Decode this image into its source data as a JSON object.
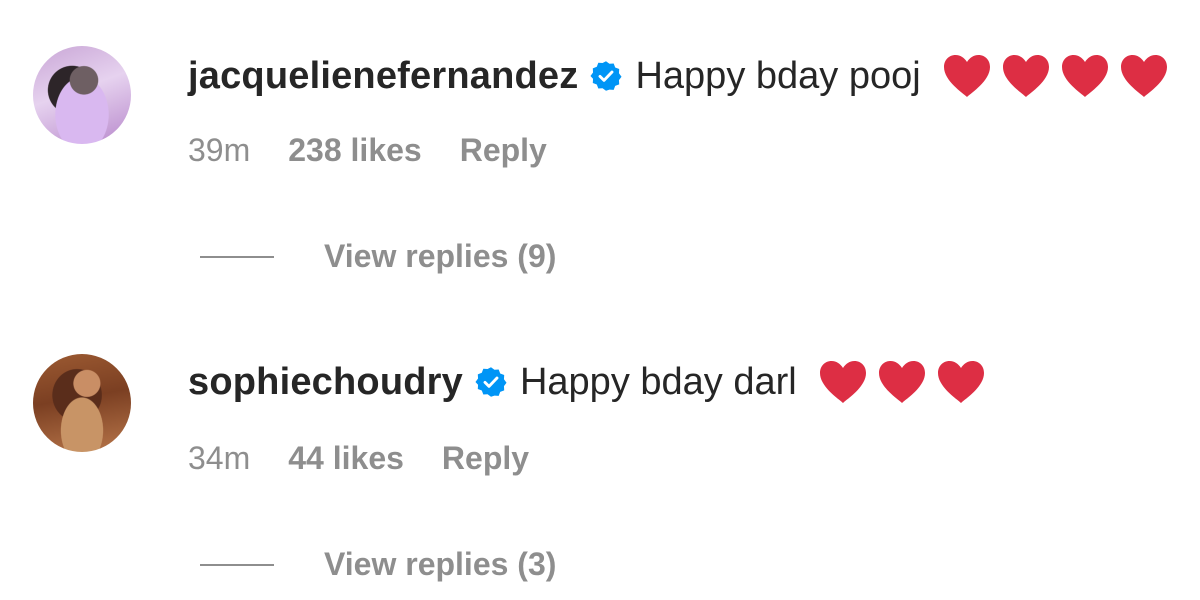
{
  "comments": [
    {
      "username": "jacquelienefernandez",
      "verified": true,
      "text": "Happy bday pooj",
      "hearts": 4,
      "time": "39m",
      "likes": "238 likes",
      "reply_label": "Reply",
      "view_replies": "View replies (9)"
    },
    {
      "username": "sophiechoudry",
      "verified": true,
      "text": "Happy bday darl",
      "hearts": 3,
      "time": "34m",
      "likes": "44 likes",
      "reply_label": "Reply",
      "view_replies": "View replies (3)"
    }
  ],
  "icons": {
    "verified": "verified-badge-icon",
    "heart": "red-heart-emoji"
  },
  "colors": {
    "text": "#262626",
    "secondary": "#8e8e8e",
    "verified_blue": "#0095f6",
    "heart_red": "#dd2e44"
  }
}
